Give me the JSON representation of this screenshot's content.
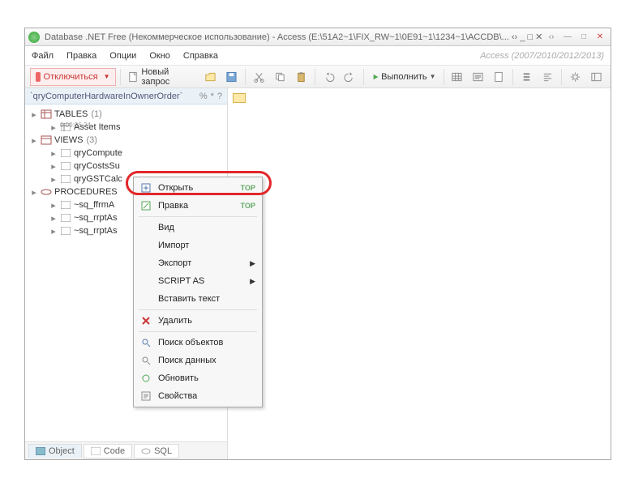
{
  "window": {
    "title": "Database .NET Free (Некоммерческое использование) - Access (E:\\51A2~1\\FIX_RW~1\\0E91~1\\1234~1\\ACCDB\\... ‹› _ □ ✕",
    "access_hint": "Access (2007/2010/2012/2013)",
    "elapsed": "0:00:06.24"
  },
  "menubar": {
    "file": "Файл",
    "edit": "Правка",
    "options": "Опции",
    "window": "Окно",
    "help": "Справка"
  },
  "toolbar": {
    "disconnect": "Отключиться",
    "new_query": "Новый запрос",
    "execute": "Выполнить"
  },
  "sidebar": {
    "header": "`qryComputerHardwareInOwnerOrder`",
    "header_right": [
      "%",
      "*",
      "?"
    ],
    "tables": {
      "label": "TABLES",
      "count": "(1)",
      "items": [
        "Asset Items"
      ]
    },
    "views": {
      "label": "VIEWS",
      "count": "(3)",
      "items": [
        "qryCompute",
        "qryCostsSu",
        "qryGSTCalc"
      ]
    },
    "procs": {
      "label": "PROCEDURES",
      "count": "",
      "items": [
        "~sq_ffrmA",
        "~sq_rrptAs",
        "~sq_rrptAs"
      ]
    }
  },
  "tabs": {
    "object": "Object",
    "code": "Code",
    "sql": "SQL"
  },
  "context_menu": {
    "open": "Открыть",
    "edit": "Правка",
    "view": "Вид",
    "import": "Импорт",
    "export": "Экспорт",
    "script_as": "SCRIPT AS",
    "insert_text": "Вставить текст",
    "delete": "Удалить",
    "find_objects": "Поиск объектов",
    "find_data": "Поиск данных",
    "refresh": "Обновить",
    "properties": "Свойства",
    "top": "TOP"
  }
}
